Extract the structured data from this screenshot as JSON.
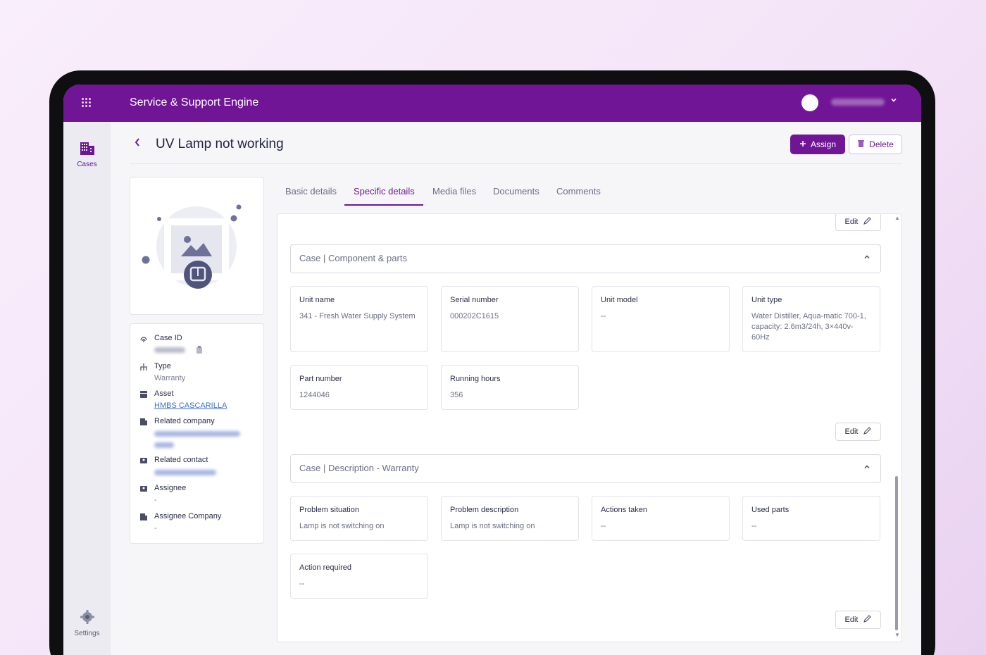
{
  "app": {
    "title": "Service & Support Engine",
    "brand_color": "#6f1596",
    "user_menu_icon": "chevron-down-icon"
  },
  "sidebar": {
    "items": [
      {
        "label": "Cases",
        "icon": "building-icon",
        "active": true
      },
      {
        "label": "Settings",
        "icon": "gear-icon",
        "active": false
      }
    ]
  },
  "header": {
    "back_icon": "chevron-left-icon",
    "title": "UV Lamp not working",
    "assign_label": "Assign",
    "delete_label": "Delete"
  },
  "info": {
    "case_id_label": "Case ID",
    "type_label": "Type",
    "type_value": "Warranty",
    "asset_label": "Asset",
    "asset_value": "HMBS CASCARILLA",
    "related_company_label": "Related company",
    "related_contact_label": "Related contact",
    "assignee_label": "Assignee",
    "assignee_value": "-",
    "assignee_company_label": "Assignee Company",
    "assignee_company_value": "-"
  },
  "tabs": [
    {
      "label": "Basic details",
      "active": false
    },
    {
      "label": "Specific details",
      "active": true
    },
    {
      "label": "Media files",
      "active": false
    },
    {
      "label": "Documents",
      "active": false
    },
    {
      "label": "Comments",
      "active": false
    }
  ],
  "edit_label": "Edit",
  "sections": {
    "component": {
      "title": "Case | Component & parts",
      "fields": [
        {
          "label": "Unit name",
          "value": "341 - Fresh Water Supply System"
        },
        {
          "label": "Serial number",
          "value": "000202C1615"
        },
        {
          "label": "Unit model",
          "value": "--"
        },
        {
          "label": "Unit type",
          "value": "Water Distiller, Aqua-matic 700-1, capacity: 2.6m3/24h, 3×440v-60Hz"
        },
        {
          "label": "Part number",
          "value": "1244046"
        },
        {
          "label": "Running hours",
          "value": "356"
        }
      ]
    },
    "description": {
      "title": "Case | Description - Warranty",
      "fields": [
        {
          "label": "Problem situation",
          "value": "Lamp is not switching on"
        },
        {
          "label": "Problem description",
          "value": "Lamp is not switching on"
        },
        {
          "label": "Actions taken",
          "value": "--"
        },
        {
          "label": "Used parts",
          "value": "--"
        },
        {
          "label": "Action required",
          "value": "--"
        }
      ]
    }
  }
}
